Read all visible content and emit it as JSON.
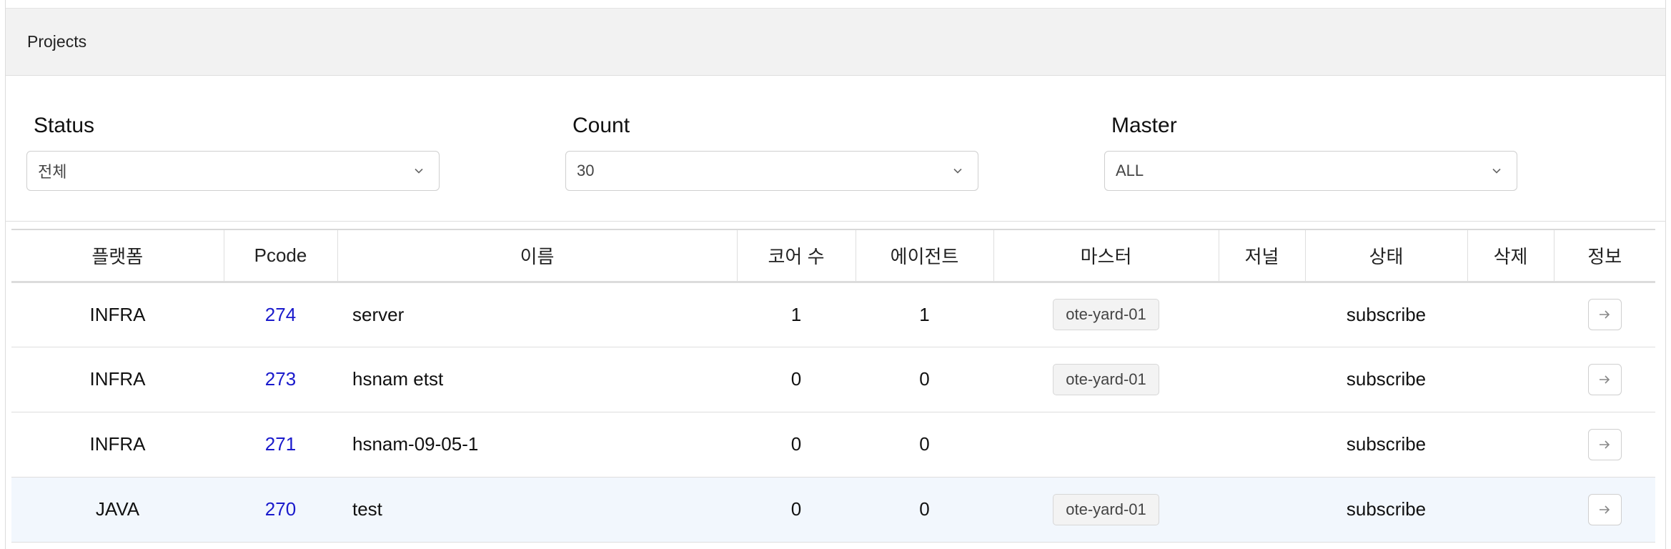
{
  "panel": {
    "title": "Projects"
  },
  "filters": {
    "status": {
      "label": "Status",
      "value": "전체"
    },
    "count": {
      "label": "Count",
      "value": "30"
    },
    "master": {
      "label": "Master",
      "value": "ALL"
    }
  },
  "table": {
    "columns": [
      "플랫폼",
      "Pcode",
      "이름",
      "코어 수",
      "에이전트",
      "마스터",
      "저널",
      "상태",
      "삭제",
      "정보"
    ],
    "rows": [
      {
        "platform": "INFRA",
        "pcode": "274",
        "name": "server",
        "cores": "1",
        "agents": "1",
        "master": "ote-yard-01",
        "journal": "",
        "status": "subscribe",
        "delete": ""
      },
      {
        "platform": "INFRA",
        "pcode": "273",
        "name": "hsnam etst",
        "cores": "0",
        "agents": "0",
        "master": "ote-yard-01",
        "journal": "",
        "status": "subscribe",
        "delete": ""
      },
      {
        "platform": "INFRA",
        "pcode": "271",
        "name": "hsnam-09-05-1",
        "cores": "0",
        "agents": "0",
        "master": "",
        "journal": "",
        "status": "subscribe",
        "delete": ""
      },
      {
        "platform": "JAVA",
        "pcode": "270",
        "name": "test",
        "cores": "0",
        "agents": "0",
        "master": "ote-yard-01",
        "journal": "",
        "status": "subscribe",
        "delete": ""
      }
    ]
  },
  "icons": {
    "select": "chevron-down-icon",
    "info": "arrow-right-icon"
  },
  "colors": {
    "link": "#1a1acc",
    "selected_row": "#f2f7fd",
    "header_bg": "#f2f2f2"
  }
}
